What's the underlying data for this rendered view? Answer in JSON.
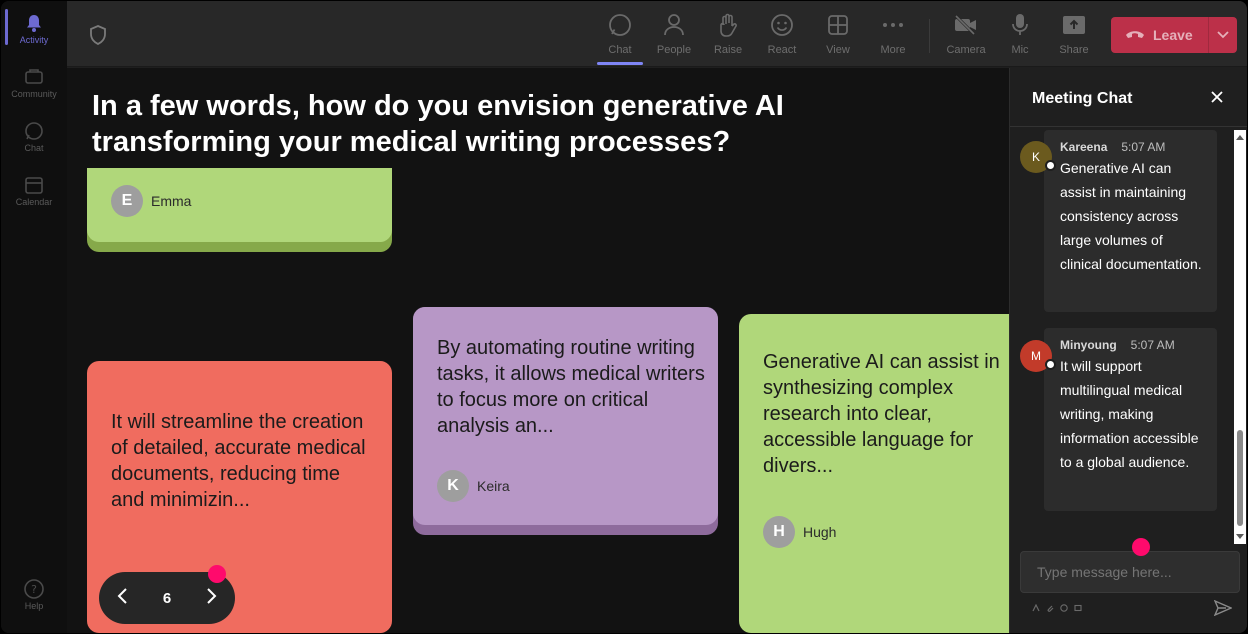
{
  "rail": {
    "items": [
      {
        "label": "Activity",
        "icon": "bell-icon"
      },
      {
        "label": "Community",
        "icon": "community-icon"
      },
      {
        "label": "Chat",
        "icon": "chat-icon"
      },
      {
        "label": "Calendar",
        "icon": "calendar-icon"
      }
    ],
    "help": {
      "label": "Help",
      "icon": "help-icon"
    }
  },
  "toolbar": {
    "items": [
      {
        "label": "Chat",
        "icon": "chat-icon"
      },
      {
        "label": "People",
        "icon": "people-icon"
      },
      {
        "label": "Raise",
        "icon": "hand-icon"
      },
      {
        "label": "React",
        "icon": "smile-icon"
      },
      {
        "label": "View",
        "icon": "grid-icon"
      },
      {
        "label": "More",
        "icon": "more-icon"
      },
      {
        "label": "Camera",
        "icon": "camera-off-icon"
      },
      {
        "label": "Mic",
        "icon": "mic-icon"
      },
      {
        "label": "Share",
        "icon": "share-icon"
      }
    ],
    "leave_label": "Leave"
  },
  "stage": {
    "question": "In a few words, how do you envision generative AI transforming your medical writing processes?",
    "cards": [
      {
        "author": "Emma",
        "initial": "E",
        "text": ""
      },
      {
        "author": "",
        "initial": "",
        "text": "It will streamline the creation of detailed, accurate medical documents, reducing time and minimizin..."
      },
      {
        "author": "Keira",
        "initial": "K",
        "text": "By automating routine writing tasks, it allows medical writers to focus more on critical analysis an..."
      },
      {
        "author": "Hugh",
        "initial": "H",
        "text": "Generative AI can assist in synthesizing complex research into clear, accessible language for divers..."
      }
    ],
    "pager": {
      "page": "6"
    }
  },
  "chat": {
    "title": "Meeting Chat",
    "messages": [
      {
        "name": "Kareena",
        "initial": "K",
        "time": "5:07 AM",
        "text": "Generative AI can assist in maintaining consistency across large volumes of clinical documentation.",
        "color": "#6b5a1e"
      },
      {
        "name": "Minyoung",
        "initial": "M",
        "time": "5:07 AM",
        "text": "It will support multilingual medical writing, making information accessible to a global audience.",
        "color": "#c23b2a"
      }
    ],
    "input_placeholder": "Type message here..."
  },
  "colors": {
    "accent": "#7f85f5",
    "leave": "#c4314b",
    "highlight_dot": "#ff0a6c"
  }
}
